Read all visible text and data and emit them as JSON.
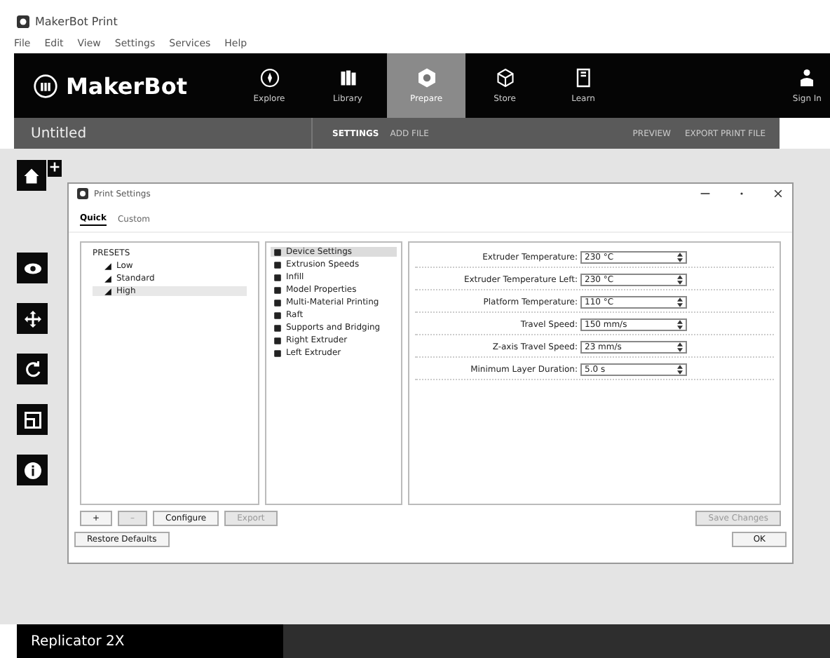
{
  "window": {
    "title": "MakerBot Print"
  },
  "menu": [
    "File",
    "Edit",
    "View",
    "Settings",
    "Services",
    "Help"
  ],
  "header": {
    "logo": "MakerBot",
    "nav": [
      {
        "label": "Explore",
        "selected": false
      },
      {
        "label": "Library",
        "selected": false
      },
      {
        "label": "Prepare",
        "selected": true
      },
      {
        "label": "Store",
        "selected": false
      },
      {
        "label": "Learn",
        "selected": false
      }
    ],
    "account": "Sign In"
  },
  "subbar": {
    "title": "Untitled",
    "left_actions": [
      "SETTINGS",
      "ADD FILE"
    ],
    "right_actions": [
      "PREVIEW",
      "EXPORT PRINT FILE"
    ]
  },
  "dialog": {
    "title": "Print Settings",
    "tabs": [
      {
        "label": "Quick",
        "selected": true
      },
      {
        "label": "Custom",
        "selected": false
      }
    ],
    "presets": {
      "heading": "PRESETS",
      "items": [
        {
          "label": "Low",
          "selected": false
        },
        {
          "label": "Standard",
          "selected": false
        },
        {
          "label": "High",
          "selected": true
        }
      ]
    },
    "categories": [
      {
        "label": "Device Settings",
        "selected": true
      },
      {
        "label": "Extrusion Speeds",
        "selected": false
      },
      {
        "label": "Infill",
        "selected": false
      },
      {
        "label": "Model Properties",
        "selected": false
      },
      {
        "label": "Multi-Material Printing",
        "selected": false
      },
      {
        "label": "Raft",
        "selected": false
      },
      {
        "label": "Supports and Bridging",
        "selected": false
      },
      {
        "label": "Right Extruder",
        "selected": false
      },
      {
        "label": "Left Extruder",
        "selected": false
      }
    ],
    "fields": [
      {
        "label": "Extruder Temperature:",
        "value": "230 °C"
      },
      {
        "label": "Extruder Temperature Left:",
        "value": "230 °C"
      },
      {
        "label": "Platform Temperature:",
        "value": "110 °C"
      },
      {
        "label": "Travel Speed:",
        "value": "150 mm/s"
      },
      {
        "label": "Z-axis Travel Speed:",
        "value": "23 mm/s"
      },
      {
        "label": "Minimum Layer Duration:",
        "value": "5.0 s"
      }
    ],
    "preset_buttons": [
      {
        "label": "+",
        "disabled": false
      },
      {
        "label": "–",
        "disabled": true
      },
      {
        "label": "Configure",
        "disabled": false
      },
      {
        "label": "Export",
        "disabled": true
      }
    ],
    "save_button": {
      "label": "Save Changes",
      "disabled": true
    },
    "restore_button": "Restore Defaults",
    "ok_button": "OK"
  },
  "status_bar": {
    "printer": "Replicator 2X"
  }
}
